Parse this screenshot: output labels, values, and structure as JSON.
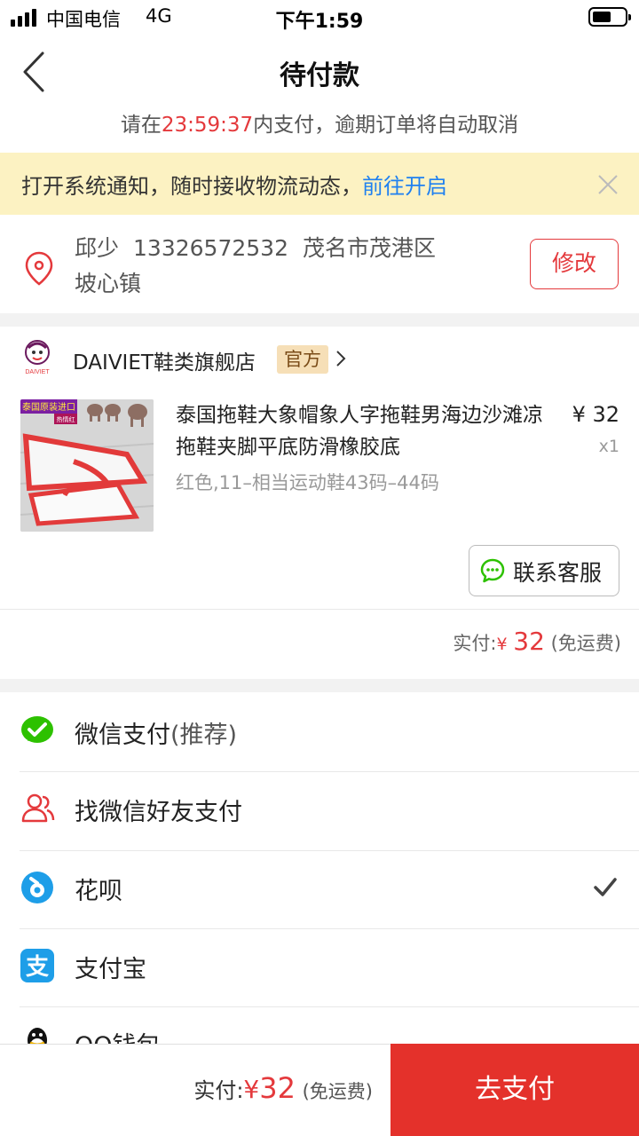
{
  "status_bar": {
    "carrier": "中国电信",
    "network": "4G",
    "time": "下午1:59"
  },
  "header": {
    "title": "待付款",
    "back_icon": "chevron-left-icon"
  },
  "countdown": {
    "prefix": "请在",
    "time": "23:59:37",
    "suffix": "内支付，逾期订单将自动取消"
  },
  "notice": {
    "text": "打开系统通知，随时接收物流动态，",
    "link": "前往开启",
    "close_icon": "close-icon"
  },
  "address": {
    "name": "邱少",
    "phone": "13326572532",
    "region": "茂名市茂港区",
    "detail": "坡心镇",
    "edit_label": "修改",
    "icon": "location-pin-icon"
  },
  "shop": {
    "name": "DAIVIET鞋类旗舰店",
    "badge": "官方",
    "logo_text": "DAIVIET"
  },
  "product": {
    "title": "泰国拖鞋大象帽象人字拖鞋男海边沙滩凉拖鞋夹脚平底防滑橡胶底",
    "price": "¥ 32",
    "quantity": "x1",
    "variant": "红色,11–相当运动鞋43码–44码",
    "image_banner": "泰国原装进口",
    "image_subbanner": "热情红"
  },
  "customer_service": {
    "label": "联系客服",
    "icon": "chat-bubble-icon"
  },
  "order_total": {
    "label": "实付:",
    "currency": "¥",
    "amount": "32",
    "shipping": "(免运费)"
  },
  "payment_methods": [
    {
      "label": "微信支付",
      "note": "(推荐)",
      "icon": "wechat-pay-icon",
      "selected": false
    },
    {
      "label": "找微信好友支付",
      "note": "",
      "icon": "friends-icon",
      "selected": false
    },
    {
      "label": "花呗",
      "note": "",
      "icon": "huabei-icon",
      "selected": true
    },
    {
      "label": "支付宝",
      "note": "",
      "icon": "alipay-icon",
      "selected": false
    },
    {
      "label": "QQ钱包",
      "note": "",
      "icon": "qq-wallet-icon",
      "selected": false
    }
  ],
  "bottom_bar": {
    "label": "实付:",
    "currency": "¥",
    "amount": "32",
    "shipping": "(免运费)",
    "pay_button": "去支付"
  },
  "colors": {
    "accent": "#e4393c",
    "link": "#1f80f0",
    "notice_bg": "#fcf2c2",
    "wechat_green": "#2dc100",
    "alipay_blue": "#1e9ee8"
  }
}
